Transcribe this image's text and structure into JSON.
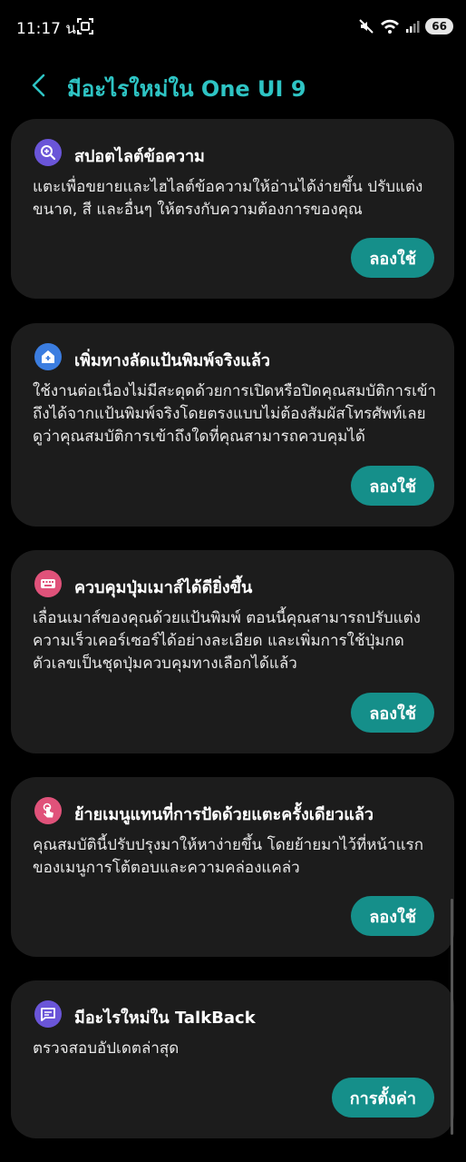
{
  "status_bar": {
    "time": "11:17 น.",
    "battery": "66"
  },
  "header": {
    "title": "มีอะไรใหม่ใน One UI 9"
  },
  "cards": [
    {
      "title": "สปอตไลต์ข้อความ",
      "description": "แตะเพื่อขยายและไฮไลต์ข้อความให้อ่านได้ง่ายขึ้น ปรับแต่งขนาด, สี และอื่นๆ ให้ตรงกับความต้องการของคุณ",
      "button": "ลองใช้",
      "icon": "zoom-in-icon",
      "icon_color": "#6a55d8"
    },
    {
      "title": "เพิ่มทางลัดแป้นพิมพ์จริงแล้ว",
      "description": "ใช้งานต่อเนื่องไม่มีสะดุดด้วยการเปิดหรือปิดคุณสมบัติการเข้าถึงได้จากแป้นพิมพ์จริงโดยตรงแบบไม่ต้องสัมผัสโทรศัพท์เลย ดูว่าคุณสมบัติการเข้าถึงใดที่คุณสามารถควบคุมได้",
      "button": "ลองใช้",
      "icon": "home-add-icon",
      "icon_color": "#3b7de0"
    },
    {
      "title": "ควบคุมปุ่มเมาส์ได้ดียิ่งขึ้น",
      "description": "เลื่อนเมาส์ของคุณด้วยแป้นพิมพ์ ตอนนี้คุณสามารถปรับแต่งความเร็วเคอร์เซอร์ได้อย่างละเอียด และเพิ่มการใช้ปุ่มกดตัวเลขเป็นชุดปุ่มควบคุมทางเลือกได้แล้ว",
      "button": "ลองใช้",
      "icon": "keyboard-icon",
      "icon_color": "#e0527a"
    },
    {
      "title": "ย้ายเมนูแทนที่การปัดด้วยแตะครั้งเดียวแล้ว",
      "description": "คุณสมบัตินี้ปรับปรุงมาให้หาง่ายขึ้น โดยย้ายมาไว้ที่หน้าแรกของเมนูการโต้ตอบและความคล่องแคล่ว",
      "button": "ลองใช้",
      "icon": "touch-icon",
      "icon_color": "#e0527a"
    },
    {
      "title": "มีอะไรใหม่ใน TalkBack",
      "description": "ตรวจสอบอัปเดตล่าสุด",
      "button": "การตั้งค่า",
      "icon": "chat-icon",
      "icon_color": "#6a55d8"
    }
  ]
}
